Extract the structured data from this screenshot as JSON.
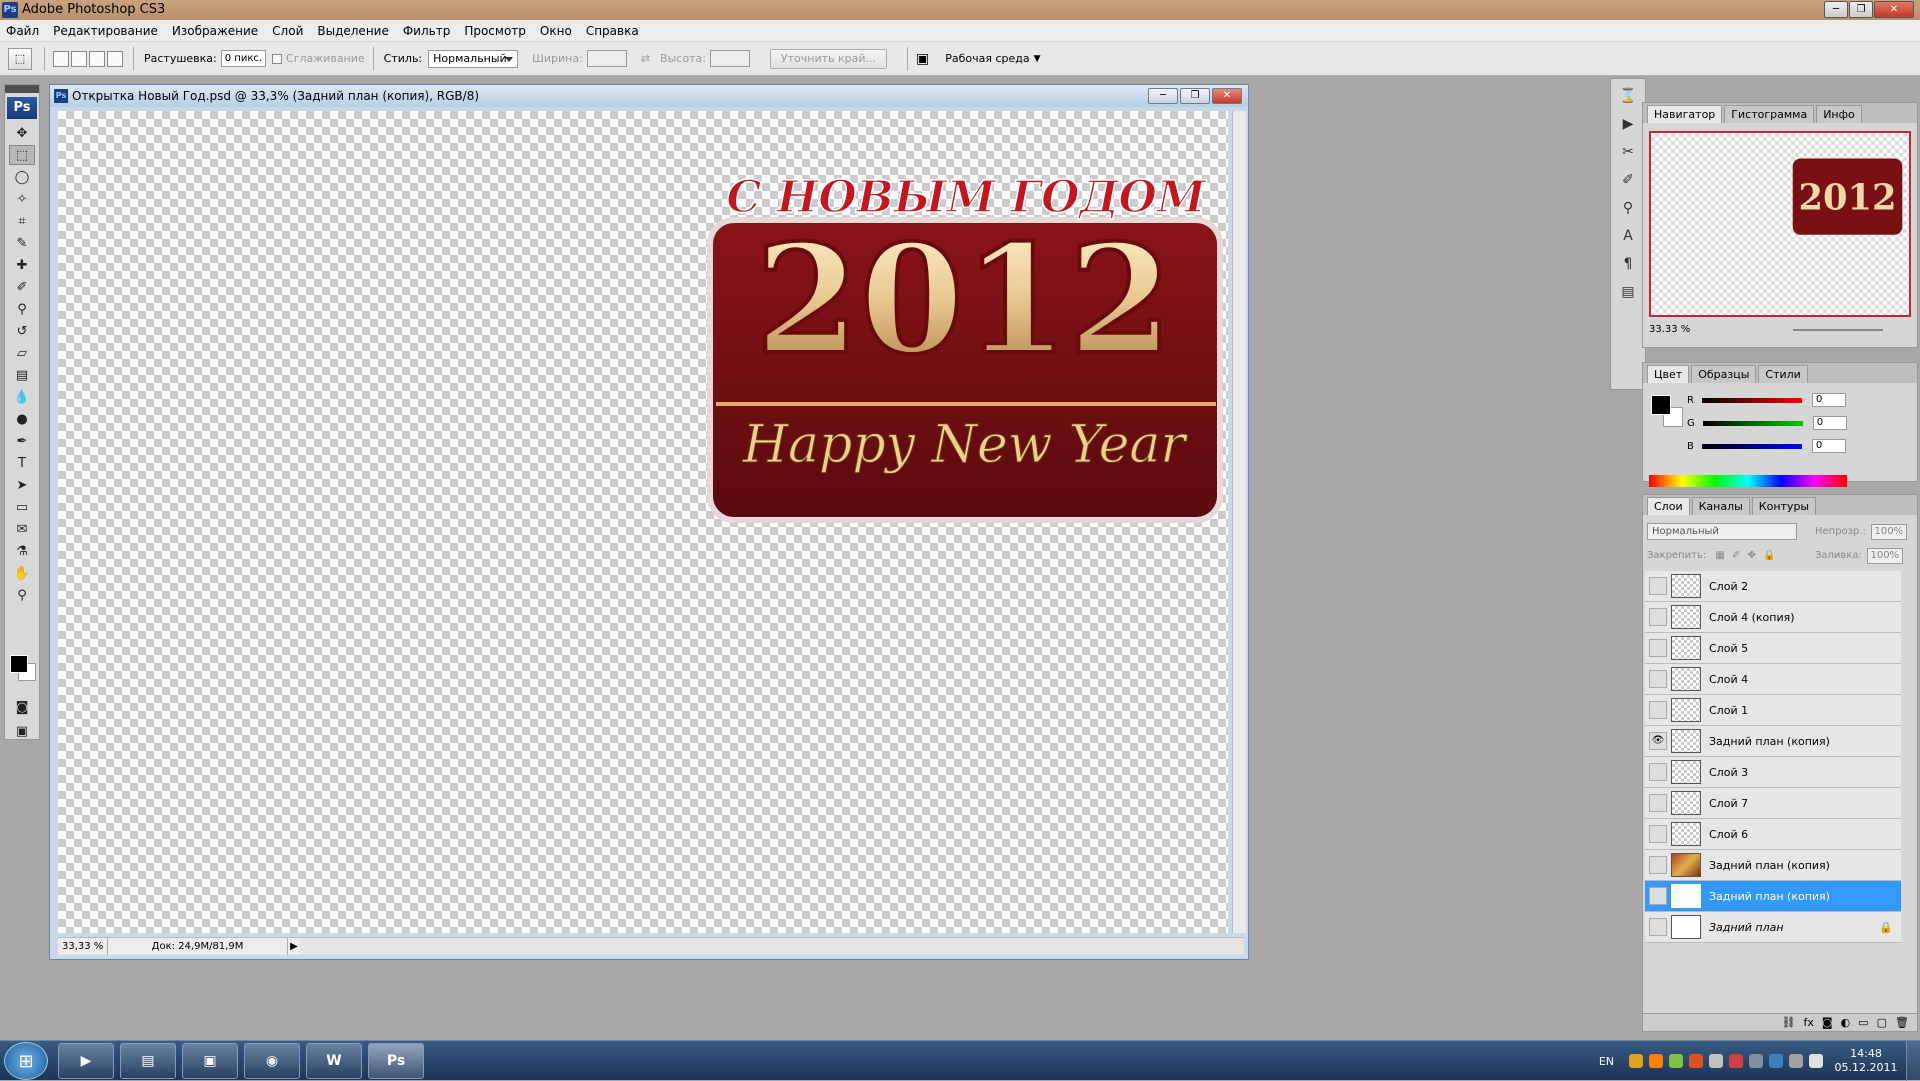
{
  "app": {
    "title": "Adobe Photoshop CS3",
    "icon_label": "Ps"
  },
  "menu": [
    "Файл",
    "Редактирование",
    "Изображение",
    "Слой",
    "Выделение",
    "Фильтр",
    "Просмотр",
    "Окно",
    "Справка"
  ],
  "options": {
    "feather_label": "Растушевка:",
    "feather_value": "0 пикс.",
    "antialias_label": "Сглаживание",
    "style_label": "Стиль:",
    "style_value": "Нормальный",
    "width_label": "Ширина:",
    "height_label": "Высота:",
    "refine_button": "Уточнить край...",
    "workspace_label": "Рабочая среда"
  },
  "document": {
    "title": "Открытка Новый Год.psd @ 33,3% (Задний план (копия), RGB/8)",
    "zoom": "33,33 %",
    "doc_info": "Док: 24,9M/81,9M"
  },
  "artwork": {
    "line1": "С НОВЫМ ГОДОМ",
    "year": "2012",
    "line3": "Happy New Year"
  },
  "navigator": {
    "tabs": [
      "Навигатор",
      "Гистограмма",
      "Инфо"
    ],
    "zoom": "33.33 %"
  },
  "color": {
    "tabs": [
      "Цвет",
      "Образцы",
      "Стили"
    ],
    "channels": [
      {
        "label": "R",
        "value": "0",
        "color": "#d00000"
      },
      {
        "label": "G",
        "value": "0",
        "color": "#00a000"
      },
      {
        "label": "B",
        "value": "0",
        "color": "#0000c0"
      }
    ]
  },
  "layers_panel": {
    "tabs": [
      "Слои",
      "Каналы",
      "Контуры"
    ],
    "blend_mode": "Нормальный",
    "opacity_label": "Непрозр.:",
    "opacity_value": "100%",
    "lock_label": "Закрепить:",
    "fill_label": "Заливка:",
    "fill_value": "100%",
    "layers": [
      {
        "name": "Слой 2",
        "visible": false,
        "selected": false,
        "thumb": "checker"
      },
      {
        "name": "Слой 4 (копия)",
        "visible": false,
        "selected": false,
        "thumb": "checker"
      },
      {
        "name": "Слой 5",
        "visible": false,
        "selected": false,
        "thumb": "checker"
      },
      {
        "name": "Слой 4",
        "visible": false,
        "selected": false,
        "thumb": "checker"
      },
      {
        "name": "Слой 1",
        "visible": false,
        "selected": false,
        "thumb": "checker"
      },
      {
        "name": "Задний план (копия)",
        "visible": true,
        "selected": false,
        "thumb": "checker"
      },
      {
        "name": "Слой 3",
        "visible": false,
        "selected": false,
        "thumb": "checker"
      },
      {
        "name": "Слой 7",
        "visible": false,
        "selected": false,
        "thumb": "checker"
      },
      {
        "name": "Слой 6",
        "visible": false,
        "selected": false,
        "thumb": "checker"
      },
      {
        "name": "Задний план (копия)",
        "visible": false,
        "selected": false,
        "thumb": "photo"
      },
      {
        "name": "Задний план (копия)",
        "visible": false,
        "selected": true,
        "thumb": "white"
      },
      {
        "name": "Задний план",
        "visible": false,
        "selected": false,
        "thumb": "white",
        "locked": true
      }
    ]
  },
  "taskbar": {
    "lang": "EN",
    "time": "14:48",
    "date": "05.12.2011",
    "apps": [
      "media-player",
      "explorer",
      "app-generic",
      "chrome",
      "word",
      "photoshop"
    ]
  }
}
